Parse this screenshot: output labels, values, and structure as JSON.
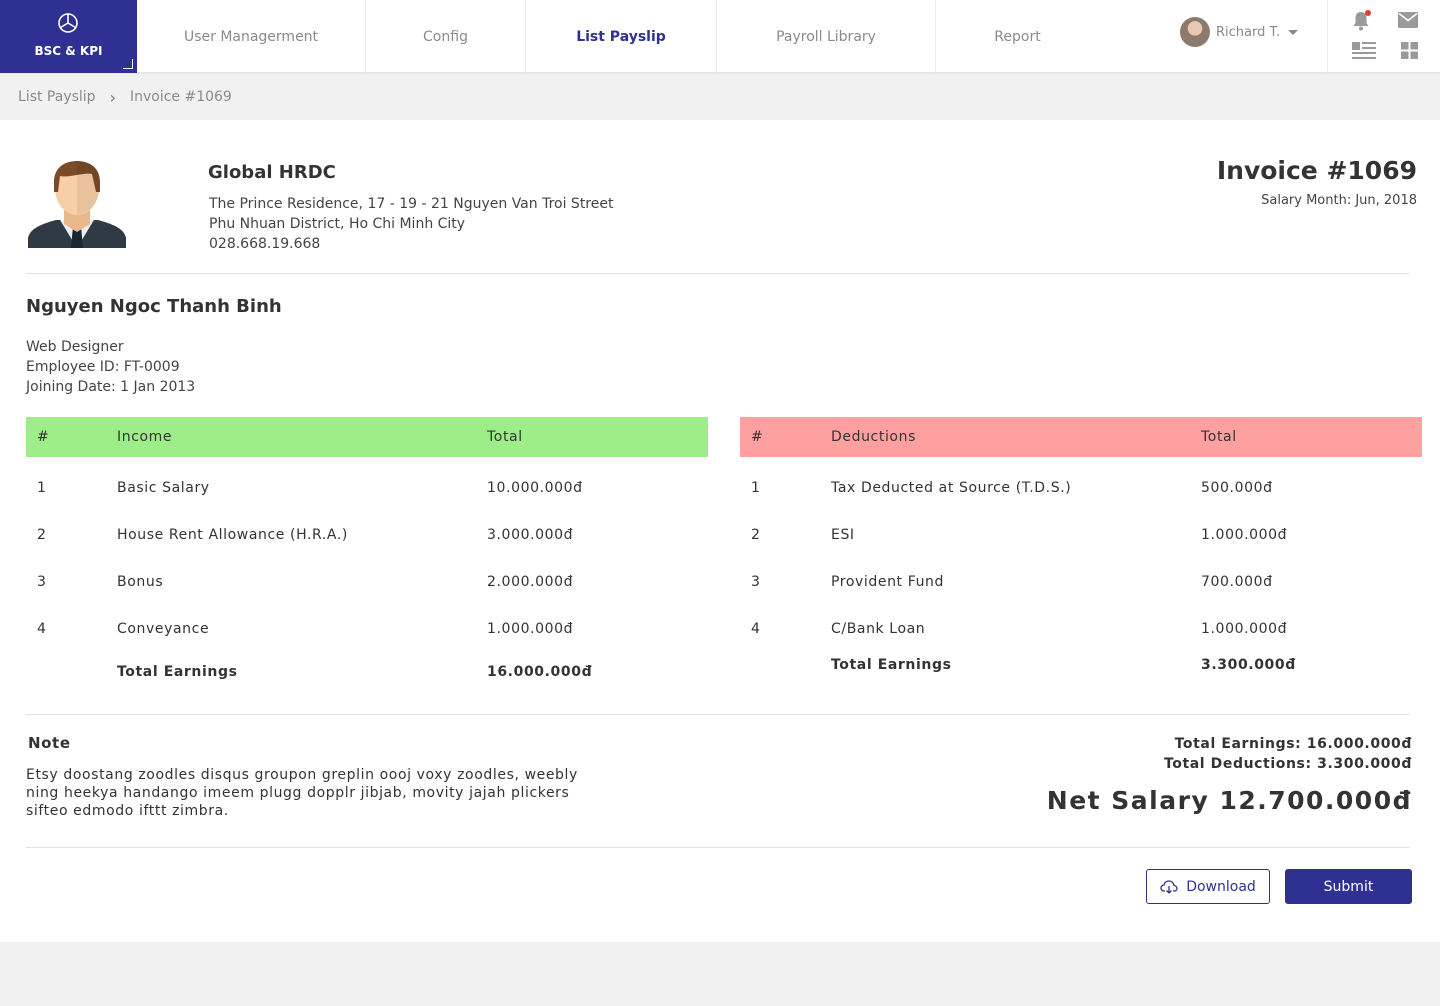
{
  "brand": {
    "name": "BSC & KPI",
    "logo_icon": "pie-chart-icon"
  },
  "nav": [
    {
      "label": "User Managerment"
    },
    {
      "label": "Config"
    },
    {
      "label": "List Payslip",
      "active": true
    },
    {
      "label": "Payroll Library"
    },
    {
      "label": "Report"
    }
  ],
  "user": {
    "name": "Richard T."
  },
  "breadcrumb": {
    "items": [
      "List Payslip",
      "Invoice #1069"
    ]
  },
  "company": {
    "name": "Global HRDC",
    "address1": "The Prince Residence, 17 - 19 - 21 Nguyen Van Troi Street",
    "address2": "Phu Nhuan District, Ho Chi Minh City",
    "phone": "028.668.19.668"
  },
  "invoice": {
    "title": "Invoice #1069",
    "month": "Salary Month: Jun, 2018"
  },
  "employee": {
    "name": "Nguyen Ngoc Thanh Binh",
    "role": "Web Designer",
    "id": "Employee ID: FT-0009",
    "joining": "Joining Date: 1 Jan 2013"
  },
  "income": {
    "headers": [
      "#",
      "Income",
      "Total"
    ],
    "rows": [
      {
        "no": "1",
        "name": "Basic Salary",
        "total": "10.000.000đ"
      },
      {
        "no": "2",
        "name": "House Rent Allowance (H.R.A.)",
        "total": "3.000.000đ"
      },
      {
        "no": "3",
        "name": "Bonus",
        "total": "2.000.000đ"
      },
      {
        "no": "4",
        "name": "Conveyance",
        "total": "1.000.000đ"
      }
    ],
    "total_label": "Total Earnings",
    "total_value": "16.000.000đ",
    "header_color": "#9dee88"
  },
  "deductions": {
    "headers": [
      "#",
      "Deductions",
      "Total"
    ],
    "rows": [
      {
        "no": "1",
        "name": "Tax Deducted at Source (T.D.S.)",
        "total": "500.000đ"
      },
      {
        "no": "2",
        "name": "ESI",
        "total": "1.000.000đ"
      },
      {
        "no": "3",
        "name": "Provident Fund",
        "total": "700.000đ"
      },
      {
        "no": "4",
        "name": "C/Bank Loan",
        "total": "1.000.000đ"
      }
    ],
    "total_label": "Total Earnings",
    "total_value": "3.300.000đ",
    "header_color": "#fea0a0"
  },
  "note": {
    "title": "Note",
    "body": "Etsy doostang zoodles disqus groupon greplin oooj voxy zoodles, weebly ning heekya handango imeem plugg dopplr jibjab, movity jajah plickers sifteo edmodo ifttt zimbra."
  },
  "summary": {
    "total_earnings": "Total Earnings: 16.000.000đ",
    "total_deductions": "Total Deductions: 3.300.000đ",
    "net_salary": "Net Salary 12.700.000đ"
  },
  "actions": {
    "download": "Download",
    "submit": "Submit"
  },
  "colors": {
    "primary": "#2e3192",
    "income_header": "#9dee88",
    "deduction_header": "#fea0a0"
  }
}
